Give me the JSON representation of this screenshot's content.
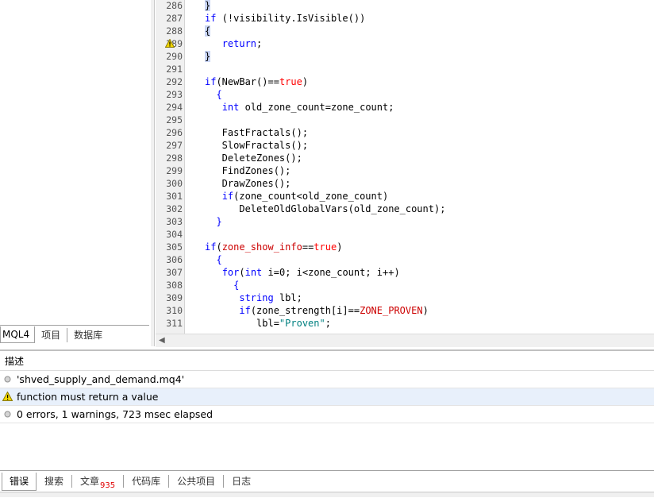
{
  "left_tabs": [
    "MQL4",
    "项目",
    "数据库"
  ],
  "editor": {
    "lines": [
      {
        "n": "286",
        "segs": [
          {
            "t": "}",
            "c": "hl"
          }
        ],
        "indent": 0
      },
      {
        "n": "287",
        "segs": [
          {
            "t": "if",
            "c": "kw"
          },
          {
            "t": " (!visibility.IsVisible())",
            "c": ""
          }
        ],
        "indent": 0
      },
      {
        "n": "288",
        "segs": [
          {
            "t": "{",
            "c": "hl"
          }
        ],
        "indent": 0
      },
      {
        "n": "289",
        "segs": [
          {
            "t": "   "
          },
          {
            "t": "return",
            "c": "kw"
          },
          {
            "t": ";",
            "c": ""
          }
        ],
        "indent": 0,
        "warn": true
      },
      {
        "n": "290",
        "segs": [
          {
            "t": "}",
            "c": "hl"
          }
        ],
        "indent": 0
      },
      {
        "n": "291",
        "segs": [],
        "indent": 0
      },
      {
        "n": "292",
        "segs": [
          {
            "t": "if",
            "c": "kw"
          },
          {
            "t": "(NewBar()=="
          },
          {
            "t": "true",
            "c": "tr"
          },
          {
            "t": ")"
          }
        ],
        "indent": 0
      },
      {
        "n": "293",
        "segs": [
          {
            "t": "  {",
            "c": "kw"
          }
        ],
        "indent": 0
      },
      {
        "n": "294",
        "segs": [
          {
            "t": "   "
          },
          {
            "t": "int",
            "c": "kw"
          },
          {
            "t": " old_zone_count=zone_count;"
          }
        ],
        "indent": 0
      },
      {
        "n": "295",
        "segs": [],
        "indent": 0
      },
      {
        "n": "296",
        "segs": [
          {
            "t": "   FastFractals();"
          }
        ],
        "indent": 0
      },
      {
        "n": "297",
        "segs": [
          {
            "t": "   SlowFractals();"
          }
        ],
        "indent": 0
      },
      {
        "n": "298",
        "segs": [
          {
            "t": "   DeleteZones();"
          }
        ],
        "indent": 0
      },
      {
        "n": "299",
        "segs": [
          {
            "t": "   FindZones();"
          }
        ],
        "indent": 0
      },
      {
        "n": "300",
        "segs": [
          {
            "t": "   DrawZones();"
          }
        ],
        "indent": 0
      },
      {
        "n": "301",
        "segs": [
          {
            "t": "   "
          },
          {
            "t": "if",
            "c": "kw"
          },
          {
            "t": "(zone_count<old_zone_count)"
          }
        ],
        "indent": 0
      },
      {
        "n": "302",
        "segs": [
          {
            "t": "      DeleteOldGlobalVars(old_zone_count);"
          }
        ],
        "indent": 0
      },
      {
        "n": "303",
        "segs": [
          {
            "t": "  }",
            "c": "kw"
          }
        ],
        "indent": 0
      },
      {
        "n": "304",
        "segs": [],
        "indent": 0
      },
      {
        "n": "305",
        "segs": [
          {
            "t": "if",
            "c": "kw"
          },
          {
            "t": "("
          },
          {
            "t": "zone_show_info",
            "c": "mac"
          },
          {
            "t": "=="
          },
          {
            "t": "true",
            "c": "tr"
          },
          {
            "t": ")"
          }
        ],
        "indent": 0
      },
      {
        "n": "306",
        "segs": [
          {
            "t": "  {",
            "c": "kw"
          }
        ],
        "indent": 0
      },
      {
        "n": "307",
        "segs": [
          {
            "t": "   "
          },
          {
            "t": "for",
            "c": "kw"
          },
          {
            "t": "("
          },
          {
            "t": "int",
            "c": "kw"
          },
          {
            "t": " i=0; i<zone_count; i++)"
          }
        ],
        "indent": 0
      },
      {
        "n": "308",
        "segs": [
          {
            "t": "     {",
            "c": "kw"
          }
        ],
        "indent": 0
      },
      {
        "n": "309",
        "segs": [
          {
            "t": "      "
          },
          {
            "t": "string",
            "c": "kw"
          },
          {
            "t": " lbl;"
          }
        ],
        "indent": 0
      },
      {
        "n": "310",
        "segs": [
          {
            "t": "      "
          },
          {
            "t": "if",
            "c": "kw"
          },
          {
            "t": "(zone_strength[i]=="
          },
          {
            "t": "ZONE_PROVEN",
            "c": "mac"
          },
          {
            "t": ")"
          }
        ],
        "indent": 0
      },
      {
        "n": "311",
        "segs": [
          {
            "t": "         lbl="
          },
          {
            "t": "\"Proven\"",
            "c": "str"
          },
          {
            "t": ";"
          }
        ],
        "indent": 0
      }
    ]
  },
  "toolbox": {
    "header": "描述",
    "messages": [
      {
        "icon": "info-dot-icon",
        "text": "'shved_supply_and_demand.mq4'"
      },
      {
        "icon": "warning-icon",
        "text": "function must return a value"
      },
      {
        "icon": "info-dot-icon",
        "text": "0 errors, 1 warnings, 723 msec elapsed"
      }
    ]
  },
  "bottom_tabs": [
    {
      "label": "错误"
    },
    {
      "label": "搜索"
    },
    {
      "label": "文章",
      "badge": "935"
    },
    {
      "label": "代码库"
    },
    {
      "label": "公共项目"
    },
    {
      "label": "日志"
    }
  ]
}
